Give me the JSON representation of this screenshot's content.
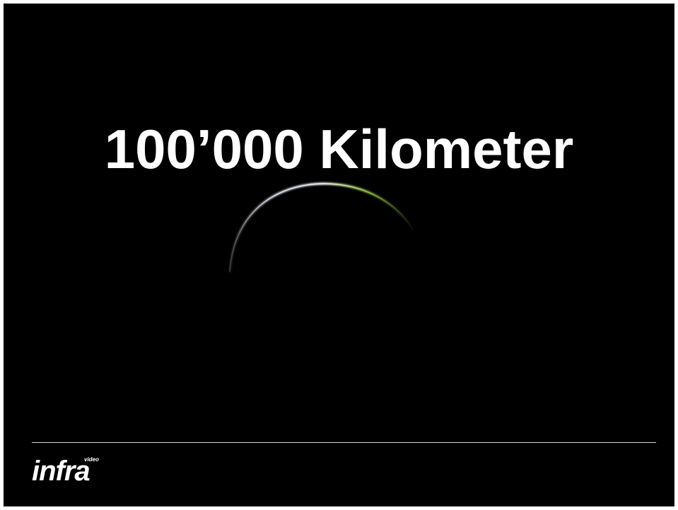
{
  "slide": {
    "title": "100’000 Kilometer",
    "background_color": "#000000",
    "text_color": "#ffffff"
  },
  "image": {
    "subject": "earth-crescent",
    "arc_colors": [
      "#e8ecff",
      "#9fd24a"
    ]
  },
  "footer": {
    "logo_text": "infra",
    "logo_subtext": "video"
  }
}
